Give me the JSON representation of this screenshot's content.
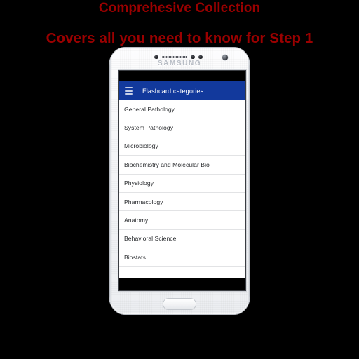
{
  "promo": {
    "line1": "Comprehesive Collection",
    "line2": "Covers all you need to know for Step 1",
    "color": "#9a0000"
  },
  "background_color": "#000000",
  "device": {
    "brand_logo": "SAMSUNG",
    "body_color": "#f4f5f7",
    "hardware": {
      "proximity_sensor": "proximity-sensor-icon",
      "speaker_grille": "speaker-grille",
      "led_indicator": "led-indicator-icon",
      "light_sensor": "light-sensor-icon",
      "front_camera": "front-camera-icon",
      "home_button": "home-button"
    }
  },
  "screen": {
    "status_bar": {
      "color": "#000000"
    },
    "app_bar": {
      "color": "#12399c",
      "menu_icon": "hamburger-icon",
      "title": "Flashcard categories"
    },
    "categories": [
      {
        "label": "General Pathology"
      },
      {
        "label": "System Pathology"
      },
      {
        "label": "Microbiology"
      },
      {
        "label": "Biochemistry and Molecular Bio"
      },
      {
        "label": "Physiology"
      },
      {
        "label": "Pharmacology"
      },
      {
        "label": "Anatomy"
      },
      {
        "label": "Behavioral Science"
      },
      {
        "label": "Biostats"
      }
    ],
    "nav_bar": {
      "color": "#000000"
    }
  }
}
